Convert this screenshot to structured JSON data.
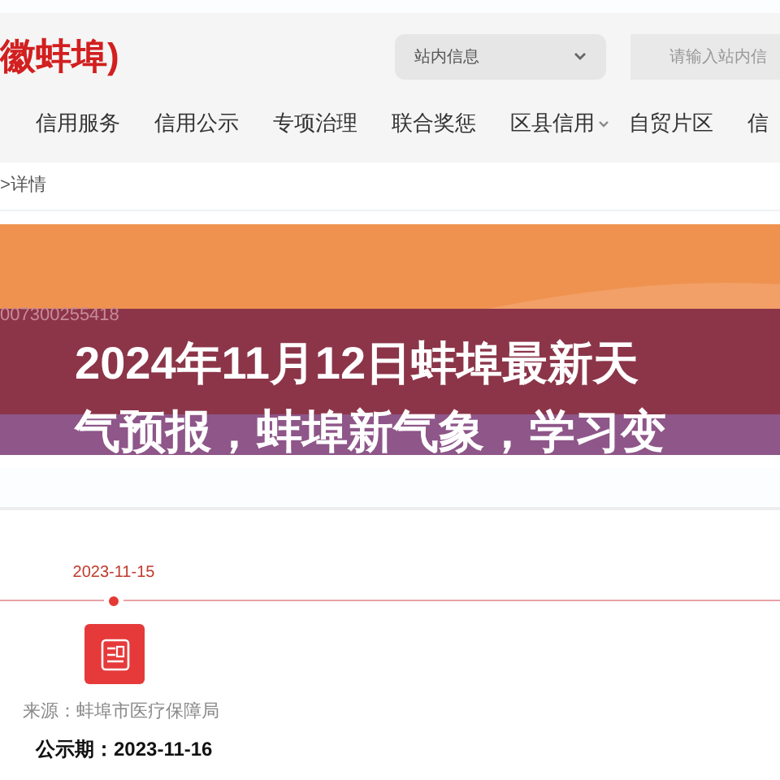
{
  "header": {
    "logo_text": "徽蚌埠)",
    "scope_select": {
      "value": "站内信息"
    },
    "search": {
      "placeholder": "请输入站内信"
    }
  },
  "nav": [
    {
      "label": "信用服务",
      "has_menu": false
    },
    {
      "label": "信用公示",
      "has_menu": false
    },
    {
      "label": "专项治理",
      "has_menu": false
    },
    {
      "label": "联合奖惩",
      "has_menu": false
    },
    {
      "label": "区县信用",
      "has_menu": true
    },
    {
      "label": "自贸片区",
      "has_menu": false
    },
    {
      "label": "信",
      "has_menu": false
    }
  ],
  "breadcrumb": ">详情",
  "banner": {
    "code": "007300255418"
  },
  "overlay_title": "2024年11月12日蚌埠最新天气预报，蚌埠新气象，学习变",
  "timeline": [
    {
      "date": "2023-11-15",
      "source": "来源：蚌埠市医疗保障局",
      "period": "公示期：2023-11-16"
    }
  ]
}
